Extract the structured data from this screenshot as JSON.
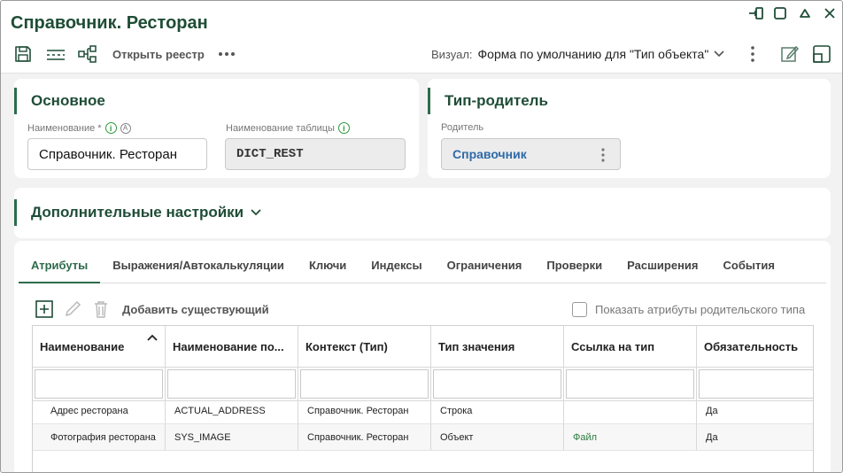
{
  "window": {
    "title": "Справочник. Ресторан"
  },
  "toolbar": {
    "open_registry": "Открыть реестр",
    "visual_label": "Визуал:",
    "visual_value": "Форма по умолчанию для \"Тип объекта\""
  },
  "main_section": {
    "title": "Основное",
    "name_label": "Наименование *",
    "name_value": "Справочник. Ресторан",
    "table_label": "Наименование таблицы",
    "table_value": "DICT_REST"
  },
  "parent_section": {
    "title": "Тип-родитель",
    "parent_label": "Родитель",
    "parent_value": "Справочник"
  },
  "extra_section": {
    "title": "Дополнительные настройки"
  },
  "tabs": [
    {
      "label": "Атрибуты"
    },
    {
      "label": "Выражения/Автокалькуляции"
    },
    {
      "label": "Ключи"
    },
    {
      "label": "Индексы"
    },
    {
      "label": "Ограничения"
    },
    {
      "label": "Проверки"
    },
    {
      "label": "Расширения"
    },
    {
      "label": "События"
    }
  ],
  "grid_toolbar": {
    "add_existing": "Добавить существующий",
    "show_parent": "Показать атрибуты родительского типа"
  },
  "grid": {
    "columns": [
      "Наименование",
      "Наименование по...",
      "Контекст (Тип)",
      "Тип значения",
      "Ссылка на тип",
      "Обязательность"
    ],
    "rows": [
      [
        "Адрес ресторана",
        "ACTUAL_ADDRESS",
        "Справочник. Ресторан",
        "Строка",
        "",
        "Да"
      ],
      [
        "Фотография ресторана",
        "SYS_IMAGE",
        "Справочник. Ресторан",
        "Объект",
        "Файл",
        "Да"
      ]
    ]
  },
  "colors": {
    "brand": "#1f4d36",
    "accent": "#2e6b4b",
    "link": "#2c7a3d"
  }
}
